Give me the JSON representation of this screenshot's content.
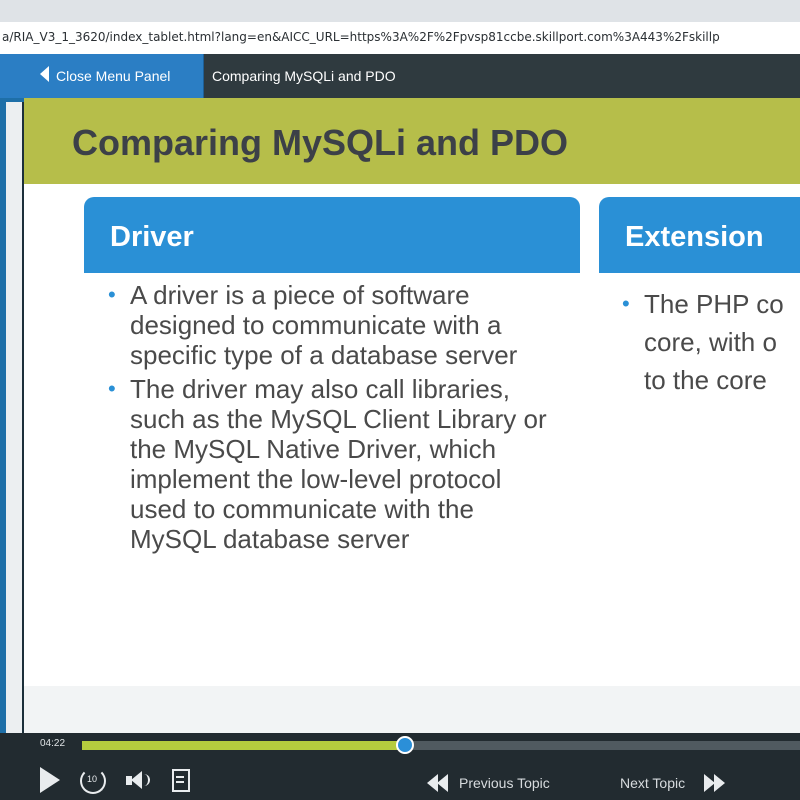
{
  "browser": {
    "url": "a/RIA_V3_1_3620/index_tablet.html?lang=en&AICC_URL=https%3A%2F%2Fpvsp81ccbe.skillport.com%3A443%2Fskillp"
  },
  "header": {
    "close_menu_label": "Close Menu Panel",
    "topic_title": "Comparing MySQLi and PDO"
  },
  "slide": {
    "title": "Comparing MySQLi and PDO",
    "cards": [
      {
        "heading": "Driver",
        "bullets": [
          "A driver is a piece of software designed to communicate with a specific type of a database server",
          "The driver may also call libraries, such as the MySQL Client Library or the MySQL Native Driver, which implement the low-level protocol used to communicate with the MySQL database server"
        ]
      },
      {
        "heading": "Extension",
        "bullets": [
          "The PHP co core, with o to the core"
        ]
      }
    ]
  },
  "player": {
    "time": "04:22",
    "progress_fraction": 0.45,
    "replay_seconds": "10",
    "previous_label": "Previous Topic",
    "next_label": "Next Topic",
    "icons": [
      "play-icon",
      "replay-10-icon",
      "volume-icon",
      "notes-icon",
      "previous-double-chevron-icon",
      "next-double-chevron-icon"
    ]
  },
  "colors": {
    "accent_blue": "#2a90d6",
    "banner_green": "#b6be4a",
    "progress_green": "#b5cc3e",
    "player_bg": "#222b30"
  }
}
